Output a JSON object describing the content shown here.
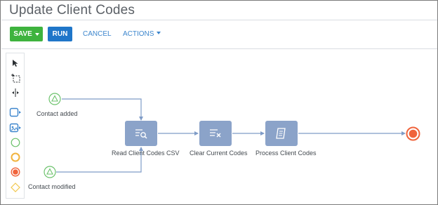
{
  "page": {
    "title": "Update Client Codes"
  },
  "toolbar": {
    "save_label": "SAVE",
    "run_label": "RUN",
    "cancel_label": "CANCEL",
    "actions_label": "ACTIONS"
  },
  "palette": {
    "tools": [
      "pointer-tool",
      "region-select-tool",
      "lane-split-tool",
      "task-tool",
      "subprocess-tool",
      "start-event-tool",
      "intermediate-event-tool",
      "end-event-tool",
      "gateway-tool"
    ]
  },
  "diagram": {
    "events": [
      {
        "id": "contact-added",
        "label": "Contact added"
      },
      {
        "id": "contact-modified",
        "label": "Contact modified"
      }
    ],
    "tasks": [
      {
        "id": "read-client-codes-csv",
        "label": "Read Client Codes CSV",
        "icon": "search-list-icon"
      },
      {
        "id": "clear-current-codes",
        "label": "Clear Current Codes",
        "icon": "clear-list-icon"
      },
      {
        "id": "process-client-codes",
        "label": "Process Client Codes",
        "icon": "script-icon"
      }
    ],
    "colors": {
      "start_event": "#6cc26c",
      "end_event": "#f0643c",
      "task_fill": "#8ba3c9",
      "connector": "#7f9cc7"
    }
  }
}
